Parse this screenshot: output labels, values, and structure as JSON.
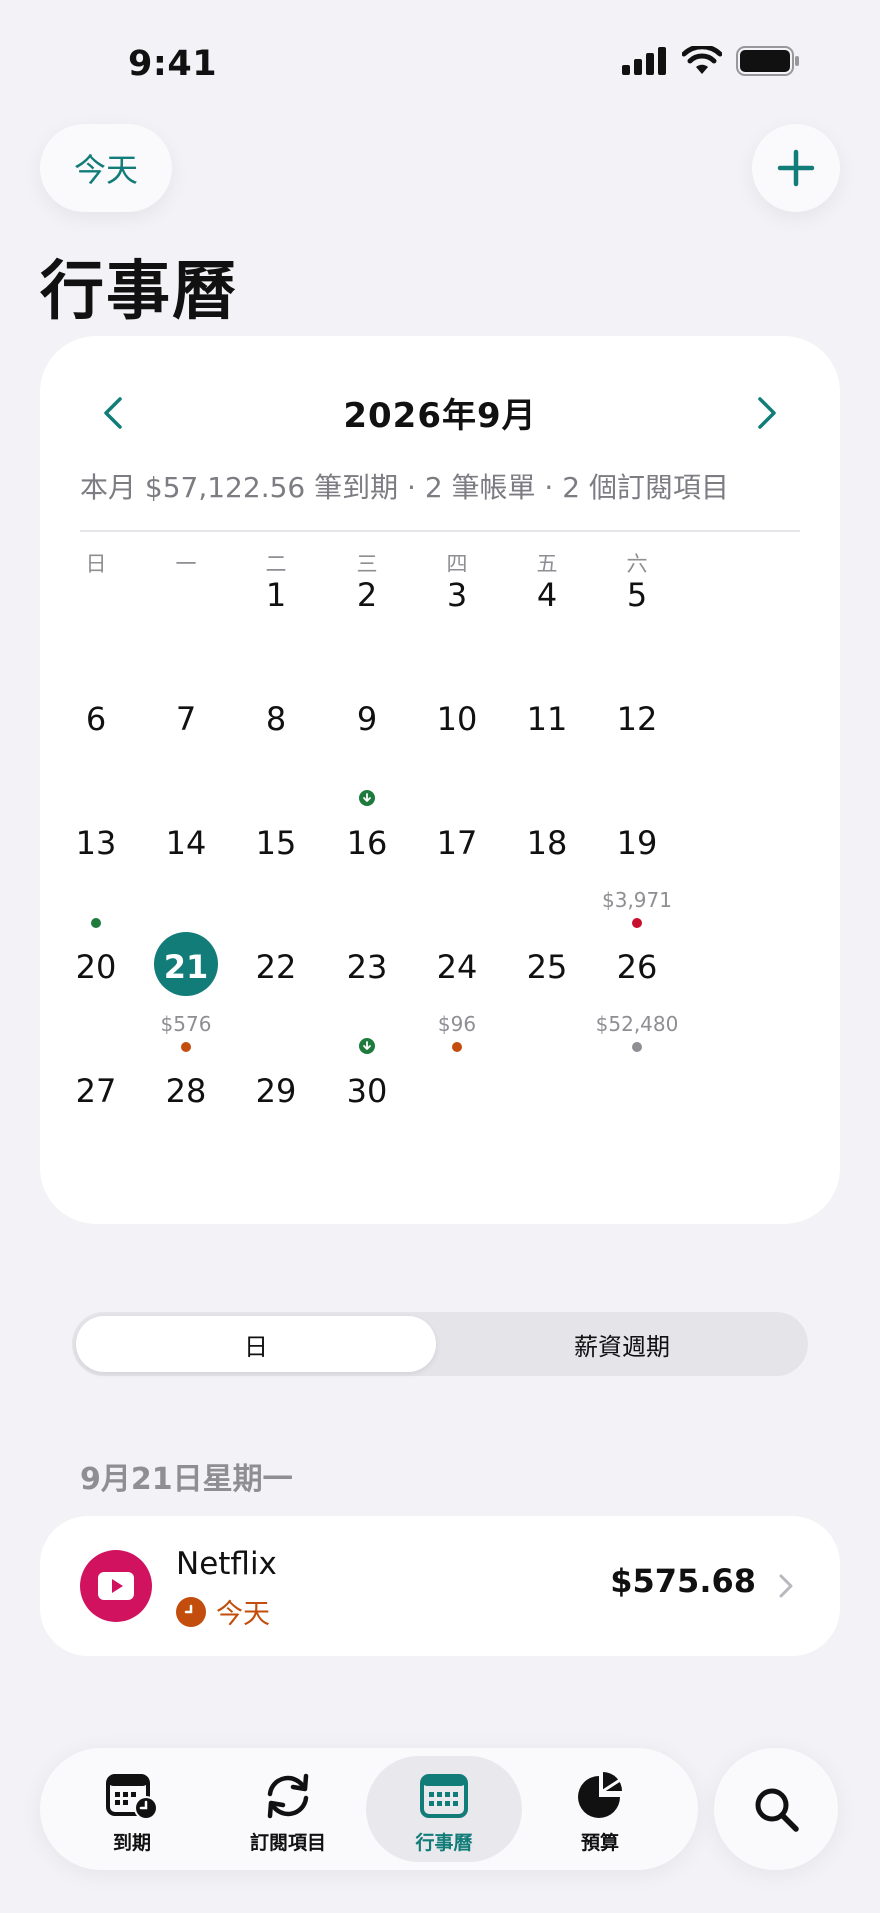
{
  "status_bar": {
    "time": "9:41"
  },
  "header": {
    "today_label": "今天",
    "add_icon": "plus-icon",
    "title": "行事曆"
  },
  "calendar": {
    "month_label": "2026年9月",
    "summary": "本月 $57,122.56 筆到期 · 2 筆帳單 · 2 個訂閱項目",
    "weekdays": [
      "日",
      "一",
      "二",
      "三",
      "四",
      "五",
      "六"
    ],
    "selected_day": "21",
    "colors": {
      "accent": "#127c78",
      "bill": "#c24d0c",
      "income": "#1f7a3e",
      "alert": "#c8102e",
      "neutral": "#8e8e93"
    },
    "weeks": [
      [
        {
          "day": ""
        },
        {
          "day": ""
        },
        {
          "day": "1"
        },
        {
          "day": "2"
        },
        {
          "day": "3"
        },
        {
          "day": "4"
        },
        {
          "day": "5"
        }
      ],
      [
        {
          "day": "6"
        },
        {
          "day": "7"
        },
        {
          "day": "8"
        },
        {
          "day": "9",
          "marker": "income-arrow-icon"
        },
        {
          "day": "10"
        },
        {
          "day": "11"
        },
        {
          "day": "12"
        }
      ],
      [
        {
          "day": "13",
          "dot": "#1f7a3e"
        },
        {
          "day": "14"
        },
        {
          "day": "15"
        },
        {
          "day": "16"
        },
        {
          "day": "17"
        },
        {
          "day": "18"
        },
        {
          "day": "19",
          "amount": "$3,971",
          "dot": "#c8102e"
        }
      ],
      [
        {
          "day": "20"
        },
        {
          "day": "21",
          "amount": "$576",
          "dot": "#c24d0c",
          "selected": true
        },
        {
          "day": "22"
        },
        {
          "day": "23",
          "marker": "income-arrow-icon"
        },
        {
          "day": "24",
          "amount": "$96",
          "dot": "#c24d0c"
        },
        {
          "day": "25"
        },
        {
          "day": "26",
          "amount": "$52,480",
          "dot": "#8e8e93"
        }
      ],
      [
        {
          "day": "27"
        },
        {
          "day": "28"
        },
        {
          "day": "29"
        },
        {
          "day": "30"
        },
        {
          "day": ""
        },
        {
          "day": ""
        },
        {
          "day": ""
        }
      ]
    ]
  },
  "segment": {
    "option_day": "日",
    "option_payperiod": "薪資週期",
    "selected": "日"
  },
  "section": {
    "date_header": "9月21日星期一"
  },
  "items": [
    {
      "name": "Netflix",
      "status": "今天",
      "amount": "$575.68",
      "icon": "play-icon",
      "icon_color": "#d1135f"
    }
  ],
  "tabbar": {
    "tabs": [
      {
        "label": "到期",
        "icon": "calendar-clock-icon"
      },
      {
        "label": "訂閱項目",
        "icon": "recurring-arrows-icon"
      },
      {
        "label": "行事曆",
        "icon": "calendar-grid-icon",
        "active": true
      },
      {
        "label": "預算",
        "icon": "pie-chart-icon"
      }
    ],
    "search_icon": "search-icon"
  }
}
